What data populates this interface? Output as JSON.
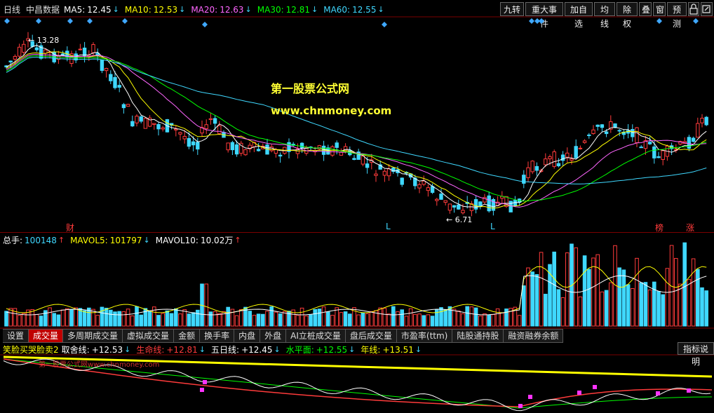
{
  "header": {
    "period": "日线",
    "stock": "中昌数据",
    "ma": [
      {
        "label": "MA5:",
        "value": "12.45",
        "arrow": "↓",
        "color": "#ffffff"
      },
      {
        "label": "MA10:",
        "value": "12.53",
        "arrow": "↓",
        "color": "#ffff00"
      },
      {
        "label": "MA20:",
        "value": "12.63",
        "arrow": "↓",
        "color": "#ff66ff"
      },
      {
        "label": "MA30:",
        "value": "12.81",
        "arrow": "↓",
        "color": "#00ff00"
      },
      {
        "label": "MA60:",
        "value": "12.55",
        "arrow": "↓",
        "color": "#3fd8ff"
      }
    ]
  },
  "toolbar": {
    "jiuzhuan": "九转",
    "major_events": "重大事件",
    "add_watch": "加自选",
    "ma_line": "均线",
    "ex_right": "除权",
    "overlay": "叠",
    "window": "窗",
    "forecast": "预测"
  },
  "chart": {
    "high_label": "13.28",
    "low_label": "6.71",
    "markers": [
      "财",
      "L",
      "L",
      "榜",
      "涨"
    ]
  },
  "watermark": {
    "name": "第一股票公式网",
    "url": "www.chnmoney.com",
    "small": "第一股票公式网www.chnmoney.com"
  },
  "volume": {
    "total_label": "总手:",
    "total_value": "100148",
    "total_arrow": "↑",
    "mavol5_label": "MAVOL5:",
    "mavol5_value": "101797",
    "mavol5_arrow": "↓",
    "mavol10_label": "MAVOL10:",
    "mavol10_value": "10.02万",
    "mavol10_arrow": "↑"
  },
  "tabs": {
    "settings": "设置",
    "items": [
      "成交量",
      "多周期成交量",
      "虚拟成交量",
      "金额",
      "换手率",
      "内盘",
      "外盘",
      "AI立桩成交量",
      "盘后成交量",
      "市盈率(ttm)",
      "陆股通持股",
      "融资融券余额"
    ]
  },
  "indicator": {
    "name": "笑脸买哭脸卖2",
    "items": [
      {
        "label": "取舍线:",
        "value": "+12.53",
        "arrow": "↓",
        "color": "#ffffff"
      },
      {
        "label": "生命线:",
        "value": "+12.81",
        "arrow": "↓",
        "color": "#ff3b3b"
      },
      {
        "label": "五日线:",
        "value": "+12.45",
        "arrow": "↓",
        "color": "#ffffff"
      },
      {
        "label": "水平面:",
        "value": "+12.55",
        "arrow": "↓",
        "color": "#00ff00"
      },
      {
        "label": "年线:",
        "value": "+13.51",
        "arrow": "↓",
        "color": "#ffff00"
      }
    ],
    "help_button": "指标说明"
  }
}
